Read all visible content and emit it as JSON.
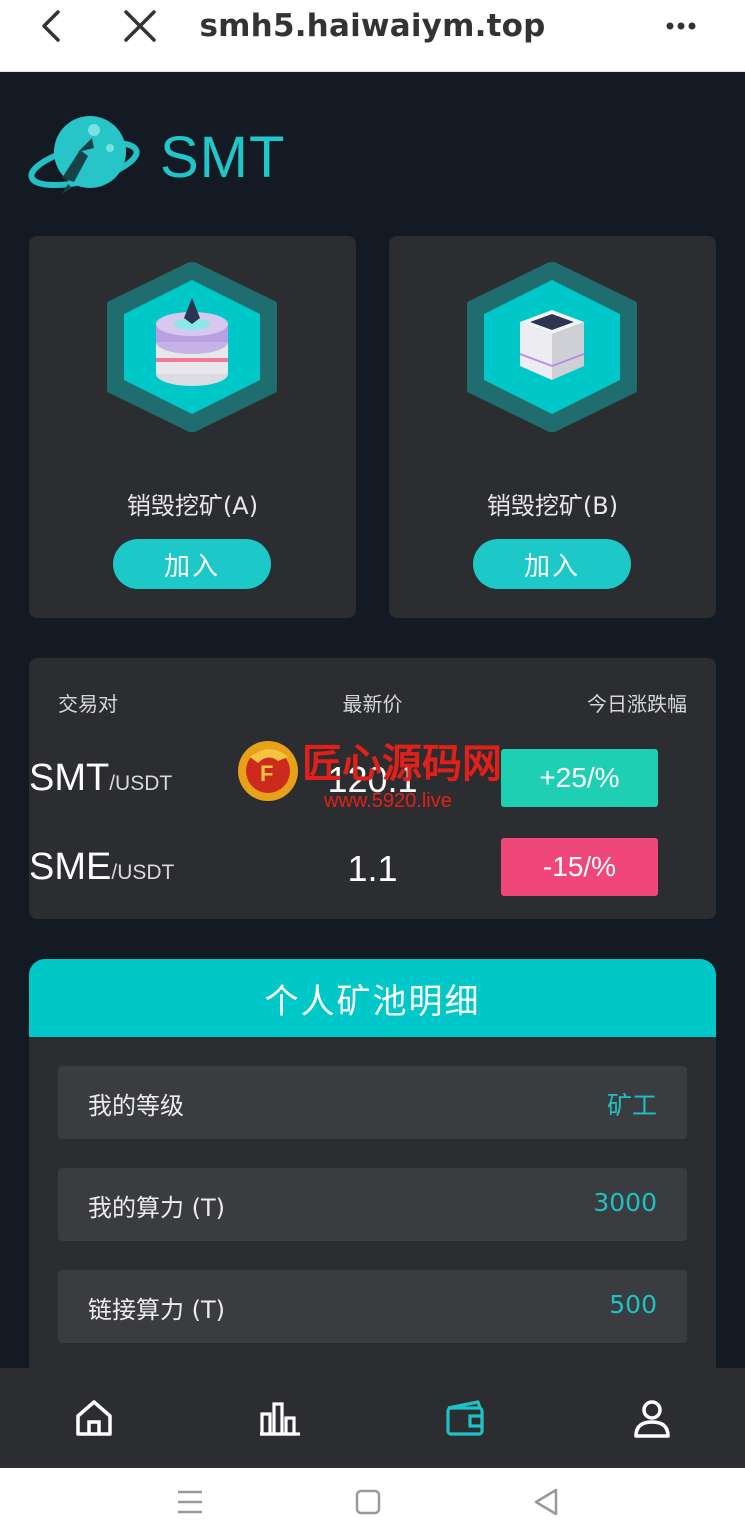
{
  "browser": {
    "url": "smh5.haiwaiym.top",
    "icons": [
      "back-icon",
      "close-icon",
      "more-icon"
    ]
  },
  "brand": {
    "name": "SMT",
    "logo_icon": "planet-rocket-logo"
  },
  "mining": [
    {
      "title": "销毁挖矿(A)",
      "button": "加入",
      "icon": "coin-stack-icon"
    },
    {
      "title": "销毁挖矿(B)",
      "button": "加入",
      "icon": "cube-box-icon"
    }
  ],
  "market": {
    "headers": {
      "pair": "交易对",
      "price": "最新价",
      "change": "今日涨跌幅"
    },
    "rows": [
      {
        "symbol": "SMT",
        "quote": "/USDT",
        "price": "120.1",
        "change": "+25/%",
        "change_color": "#1ecfb3"
      },
      {
        "symbol": "SME",
        "quote": "/USDT",
        "price": "1.1",
        "change": "-15/%",
        "change_color": "#f0477a"
      }
    ]
  },
  "pool": {
    "title": "个人矿池明细",
    "rows": [
      {
        "label": "我的等级",
        "value": "矿工"
      },
      {
        "label": "我的算力 (T)",
        "value": "3000"
      },
      {
        "label": "链接算力 (T)",
        "value": "500"
      }
    ]
  },
  "watermark": {
    "text": "匠心源码网",
    "url": "www.5920.live"
  },
  "tabbar": {
    "items": [
      "home-icon",
      "chart-icon",
      "wallet-icon",
      "profile-icon"
    ],
    "active": "wallet-icon"
  },
  "colors": {
    "accent": "#00c8c8",
    "background": "#141a23",
    "card": "#2b2d30"
  }
}
